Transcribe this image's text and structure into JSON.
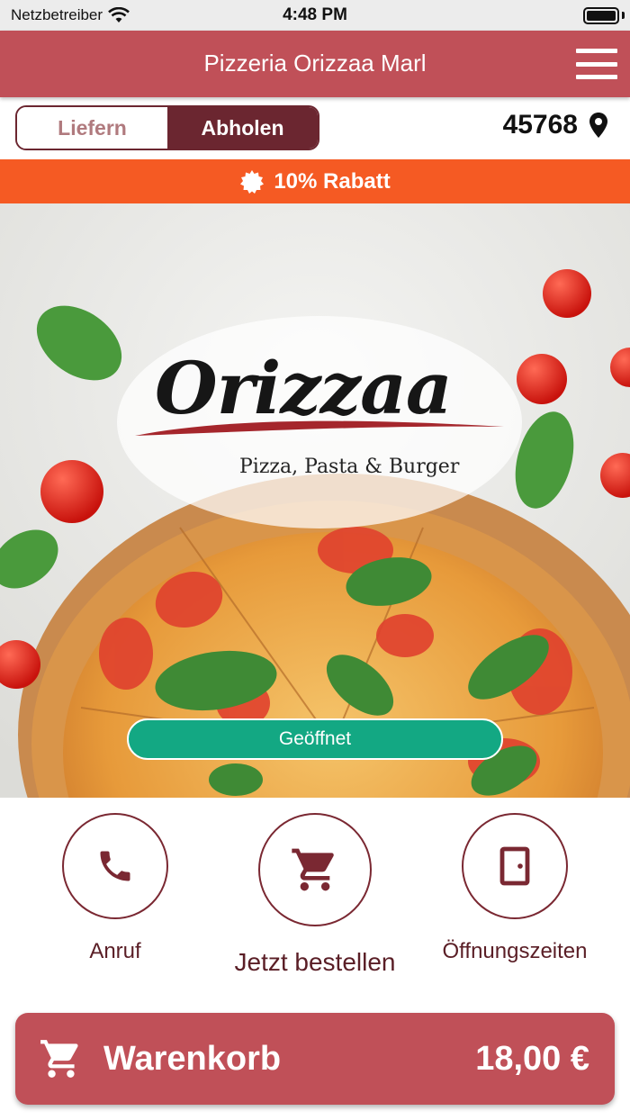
{
  "status_bar": {
    "carrier": "Netzbetreiber",
    "time": "4:48 PM",
    "battery_level": 1.0
  },
  "header": {
    "title": "Pizzeria Orizzaa Marl",
    "menu_icon": "hamburger-menu-icon"
  },
  "order_mode": {
    "options": [
      "Liefern",
      "Abholen"
    ],
    "selected": "Abholen"
  },
  "location": {
    "postal_code": "45768",
    "icon": "location-pin-icon"
  },
  "discount_banner": {
    "text": "10% Rabatt",
    "icon": "badge-icon",
    "color": "#f55a23"
  },
  "hero": {
    "logo_text": "Orizzaa",
    "logo_tagline": "Pizza, Pasta & Burger",
    "status": "Geöffnet",
    "status_color": "#13a883"
  },
  "actions": [
    {
      "label": "Anruf",
      "icon": "phone-icon"
    },
    {
      "label": "Jetzt bestellen",
      "icon": "cart-icon"
    },
    {
      "label": "Öffnungszeiten",
      "icon": "door-icon"
    }
  ],
  "cart": {
    "label": "Warenkorb",
    "total": "18,00 €",
    "icon": "cart-icon"
  },
  "colors": {
    "primary": "#c05058",
    "dark_accent": "#6b2630"
  }
}
